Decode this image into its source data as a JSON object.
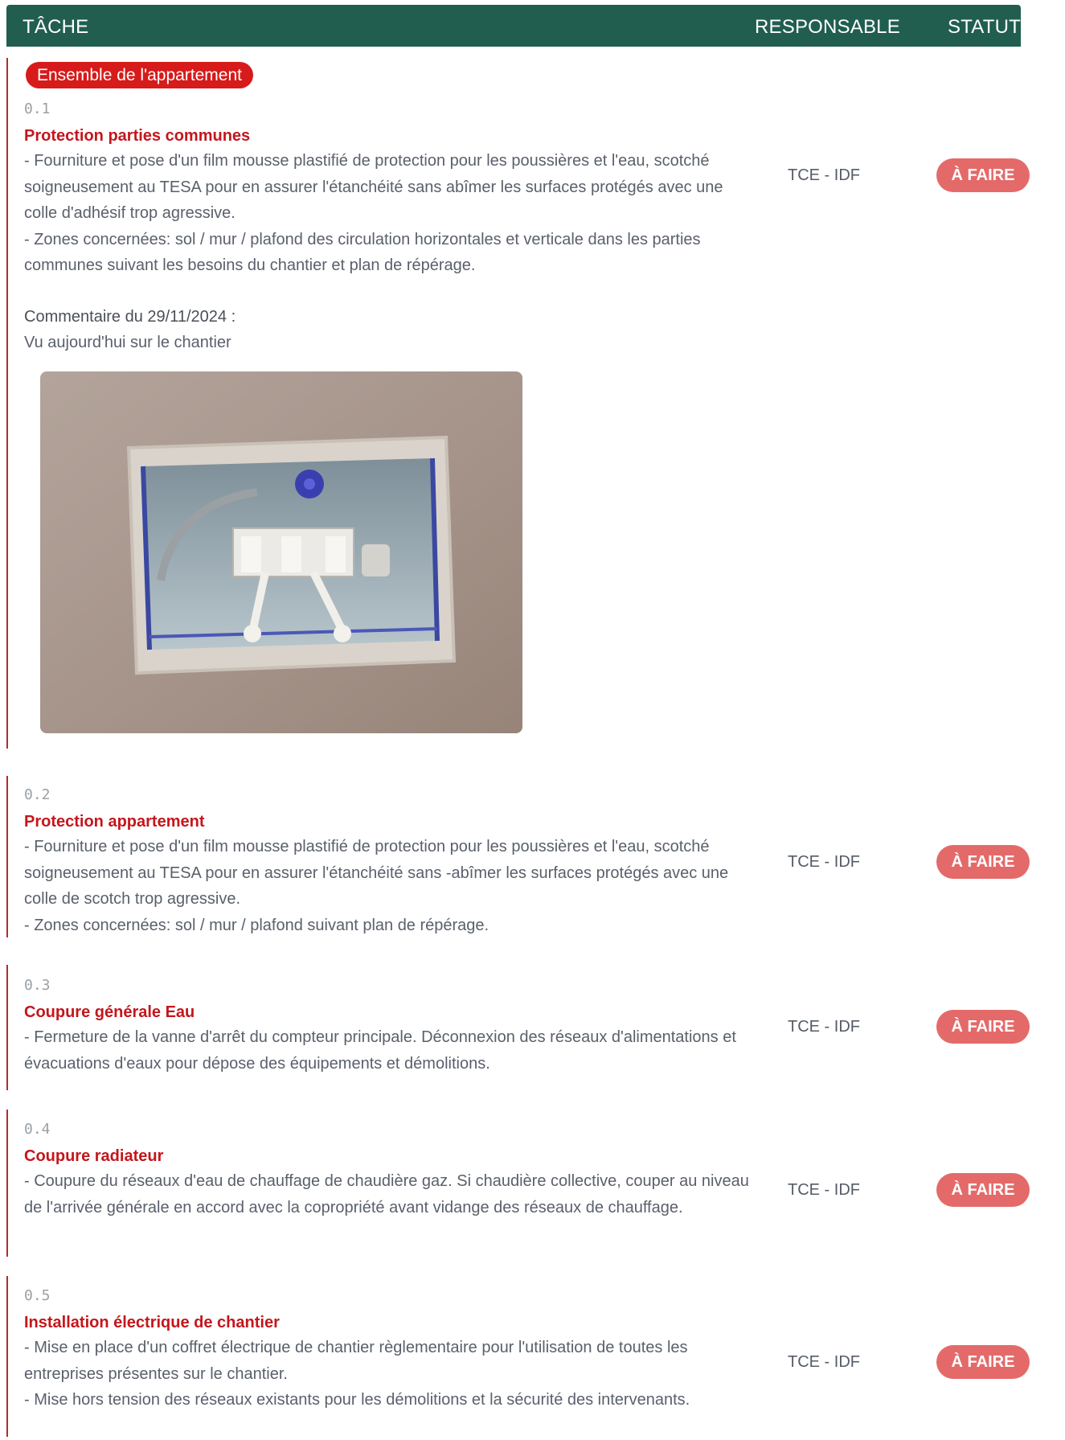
{
  "header": {
    "task_label": "TÂCHE",
    "responsible_label": "RESPONSABLE",
    "status_label": "STATUT"
  },
  "group": {
    "label": "Ensemble de l'appartement"
  },
  "tasks": [
    {
      "number": "0.1",
      "title": "Protection parties communes",
      "description": "- Fourniture et pose d'un film mousse plastifié de protection pour les poussières et l'eau, scotché soigneusement au TESA pour en assurer l'étanchéité sans abîmer les surfaces protégés avec une colle d'adhésif trop agressive.\n- Zones concernées: sol / mur / plafond des circulation horizontales et verticale dans les parties communes suivant les besoins du chantier et plan de répérage.",
      "responsible": "TCE - IDF",
      "status": "À FAIRE",
      "comment": {
        "heading": "Commentaire du 29/11/2024 :",
        "text": "Vu aujourd'hui sur le chantier"
      }
    },
    {
      "number": "0.2",
      "title": "Protection appartement",
      "description": "- Fourniture et pose d'un film mousse plastifié de protection pour les poussières et l'eau, scotché soigneusement au TESA pour en assurer l'étanchéité sans -abîmer les surfaces protégés avec une colle de scotch trop agressive.\n- Zones concernées: sol / mur / plafond suivant plan de répérage.",
      "responsible": "TCE - IDF",
      "status": "À FAIRE"
    },
    {
      "number": "0.3",
      "title": "Coupure générale Eau",
      "description": "- Fermeture de la vanne d'arrêt du compteur principale. Déconnexion des réseaux d'alimentations et évacuations d'eaux pour dépose des équipements et démolitions.",
      "responsible": "TCE - IDF",
      "status": "À FAIRE"
    },
    {
      "number": "0.4",
      "title": "Coupure radiateur",
      "description": "- Coupure du réseaux d'eau de chauffage de chaudière gaz. Si chaudière collective, couper au niveau de l'arrivée générale en accord avec la copropriété avant vidange des réseaux de chauffage.",
      "responsible": "TCE - IDF",
      "status": "À FAIRE"
    },
    {
      "number": "0.5",
      "title": "Installation électrique de chantier",
      "description": "- Mise en place d'un coffret électrique de chantier règlementaire pour l'utilisation de toutes les entreprises présentes sur le chantier.\n- Mise hors tension des réseaux existants pour les démolitions et la sécurité des intervenants.",
      "responsible": "TCE - IDF",
      "status": "À FAIRE"
    }
  ],
  "colors": {
    "header_bg": "#215e4f",
    "accent_red": "#c4161c",
    "badge_bg": "#e46a6a"
  }
}
